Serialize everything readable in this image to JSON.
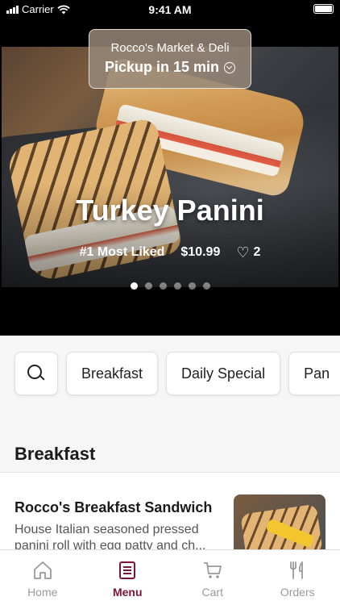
{
  "status_bar": {
    "carrier": "Carrier",
    "time": "9:41 AM"
  },
  "hero": {
    "store_name": "Rocco's Market & Deli",
    "pickup_text": "Pickup in 15 min",
    "title": "Turkey Panini",
    "badge": "#1 Most Liked",
    "price": "$10.99",
    "likes": "2",
    "carousel": {
      "count": 6,
      "active_index": 0
    }
  },
  "categories": [
    {
      "label": "Breakfast"
    },
    {
      "label": "Daily Special"
    },
    {
      "label": "Pan"
    }
  ],
  "section": {
    "title": "Breakfast"
  },
  "menu_item": {
    "name": "Rocco's Breakfast Sandwich",
    "description": "House Italian seasoned pressed panini roll with egg patty and ch..."
  },
  "tabs": [
    {
      "label": "Home",
      "icon": "home-icon",
      "active": false
    },
    {
      "label": "Menu",
      "icon": "menu-icon",
      "active": true
    },
    {
      "label": "Cart",
      "icon": "cart-icon",
      "active": false
    },
    {
      "label": "Orders",
      "icon": "orders-icon",
      "active": false
    }
  ],
  "colors": {
    "accent": "#7c1436",
    "inactive_tab": "#9a9a9a",
    "background": "#f6f6f6"
  }
}
